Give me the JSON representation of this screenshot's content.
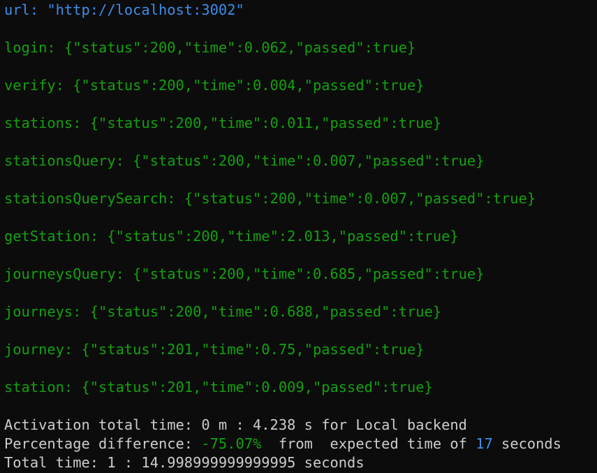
{
  "url_line": {
    "label": "url: ",
    "value": "\"http://localhost:3002\""
  },
  "results": [
    {
      "name": "login: ",
      "json": "{\"status\":200,\"time\":0.062,\"passed\":true}"
    },
    {
      "name": "verify: ",
      "json": "{\"status\":200,\"time\":0.004,\"passed\":true}"
    },
    {
      "name": "stations: ",
      "json": "{\"status\":200,\"time\":0.011,\"passed\":true}"
    },
    {
      "name": "stationsQuery: ",
      "json": "{\"status\":200,\"time\":0.007,\"passed\":true}"
    },
    {
      "name": "stationsQuerySearch: ",
      "json": "{\"status\":200,\"time\":0.007,\"passed\":true}"
    },
    {
      "name": "getStation: ",
      "json": "{\"status\":200,\"time\":2.013,\"passed\":true}"
    },
    {
      "name": "journeysQuery: ",
      "json": "{\"status\":200,\"time\":0.685,\"passed\":true}"
    },
    {
      "name": "journeys: ",
      "json": "{\"status\":200,\"time\":0.688,\"passed\":true}"
    },
    {
      "name": "journey: ",
      "json": "{\"status\":201,\"time\":0.75,\"passed\":true}"
    },
    {
      "name": "station: ",
      "json": "{\"status\":201,\"time\":0.009,\"passed\":true}"
    }
  ],
  "activation_line": "Activation total time: 0 m : 4.238 s for Local backend",
  "percentage_line": {
    "prefix": "Percentage difference: ",
    "percent": "-75.07%",
    "middle": "  from  expected time of ",
    "expected": "17",
    "suffix": " seconds"
  },
  "total_line": "Total time: 1 : 14.998999999999995 seconds",
  "colors": {
    "background": "#0c0c0c",
    "text": "#cccccc",
    "green": "#13a10e",
    "blue": "#3b8eea"
  }
}
